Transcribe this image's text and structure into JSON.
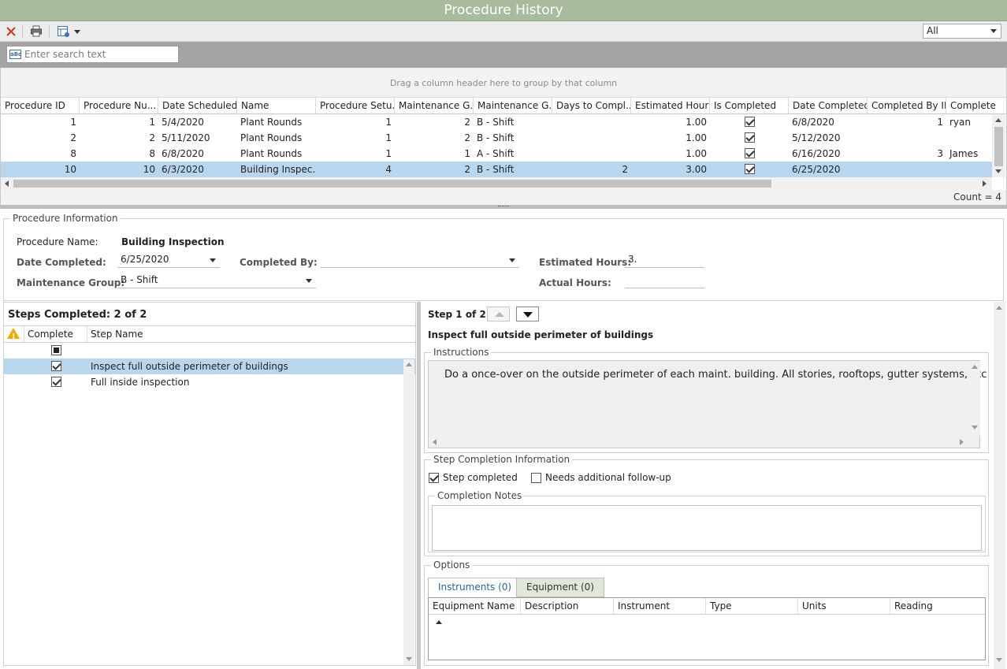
{
  "window": {
    "title": "Procedure History"
  },
  "toolbar": {
    "filter_value": "All",
    "icons": [
      "close-icon",
      "print-icon",
      "layout-icon"
    ]
  },
  "search": {
    "placeholder": "Enter search text"
  },
  "grid": {
    "group_hint": "Drag a column header here to group by that column",
    "columns": [
      "Procedure ID",
      "Procedure Nu...",
      "Date Scheduled",
      "Name",
      "Procedure Setu...",
      "Maintenance G...",
      "Maintenance G...",
      "Days to Compl...",
      "Estimated Hours",
      "Is Completed",
      "Date Completed",
      "Completed By ID",
      "Complete"
    ],
    "rows": [
      {
        "id": "1",
        "num": "1",
        "date_sched": "5/4/2020",
        "name": "Plant Rounds",
        "setup": "1",
        "mg_id": "2",
        "mg_name": "B - Shift",
        "days": "",
        "est": "1.00",
        "done": true,
        "date_done": "6/8/2020",
        "by_id": "1",
        "by": "ryan"
      },
      {
        "id": "2",
        "num": "2",
        "date_sched": "5/11/2020",
        "name": "Plant Rounds",
        "setup": "1",
        "mg_id": "2",
        "mg_name": "B - Shift",
        "days": "",
        "est": "1.00",
        "done": true,
        "date_done": "5/12/2020",
        "by_id": "",
        "by": ""
      },
      {
        "id": "8",
        "num": "8",
        "date_sched": "6/8/2020",
        "name": "Plant Rounds",
        "setup": "1",
        "mg_id": "1",
        "mg_name": "A - Shift",
        "days": "",
        "est": "1.00",
        "done": true,
        "date_done": "6/16/2020",
        "by_id": "3",
        "by": "James"
      },
      {
        "id": "10",
        "num": "10",
        "date_sched": "6/3/2020",
        "name": "Building Inspec...",
        "setup": "4",
        "mg_id": "2",
        "mg_name": "B - Shift",
        "days": "2",
        "est": "3.00",
        "done": true,
        "date_done": "6/25/2020",
        "by_id": "",
        "by": ""
      }
    ],
    "count_text": "Count = 4"
  },
  "procedure_info": {
    "legend": "Procedure Information",
    "name_label": "Procedure Name:",
    "name_value": "Building Inspection",
    "date_completed_label": "Date Completed:",
    "date_completed_value": "6/25/2020",
    "completed_by_label": "Completed By:",
    "completed_by_value": "",
    "estimated_hours_label": "Estimated Hours:",
    "estimated_hours_value": "3.",
    "maintenance_group_label": "Maintenance Group:",
    "maintenance_group_value": "B - Shift",
    "actual_hours_label": "Actual Hours:",
    "actual_hours_value": ""
  },
  "steps": {
    "title": "Steps Completed:  2 of 2",
    "columns": [
      "Complete",
      "Step Name"
    ],
    "rows": [
      {
        "complete": true,
        "name": "Inspect full outside perimeter of buildings"
      },
      {
        "complete": true,
        "name": "Full inside inspection"
      }
    ]
  },
  "step_detail": {
    "step_label": "Step 1 of 2",
    "step_title": "Inspect full outside perimeter of buildings",
    "instructions_legend": "Instructions",
    "instructions_text": "Do a once-over on the outside perimeter of each maint. building.   All stories, rooftops, gutter systems, etc",
    "completion_legend": "Step Completion Information",
    "step_completed_label": "Step completed",
    "step_completed": true,
    "followup_label": "Needs additional follow-up",
    "followup": false,
    "notes_legend": "Completion Notes",
    "notes_value": ""
  },
  "options": {
    "legend": "Options",
    "tabs": [
      {
        "label": "Instruments  (0)"
      },
      {
        "label": "Equipment  (0)"
      }
    ],
    "columns": [
      "Equipment Name",
      "Description",
      "Instrument",
      "Type",
      "Units",
      "Reading"
    ]
  }
}
